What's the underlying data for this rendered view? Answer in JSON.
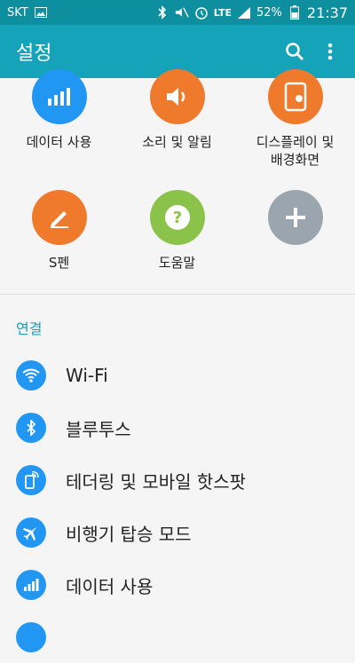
{
  "status": {
    "carrier": "SKT",
    "network": "LTE",
    "battery": "52%",
    "time": "21:37"
  },
  "appbar": {
    "title": "설정"
  },
  "quick_settings": {
    "row1": [
      "데이터 사용",
      "소리 및 알림",
      "디스플레이 및\n배경화면"
    ],
    "row2": [
      "S펜",
      "도움말",
      ""
    ]
  },
  "connection": {
    "section_title": "연결",
    "items": [
      "Wi-Fi",
      "블루투스",
      "테더링 및 모바일 핫스팟",
      "비행기 탑승 모드",
      "데이터 사용"
    ]
  },
  "colors": {
    "appbar": "#14a3b8",
    "statusbar": "#0e8fa0",
    "accent": "#1a9fb5",
    "blue": "#2196f3",
    "orange": "#f07a2c",
    "green": "#8bc34a",
    "gray": "#9aa5ad"
  }
}
